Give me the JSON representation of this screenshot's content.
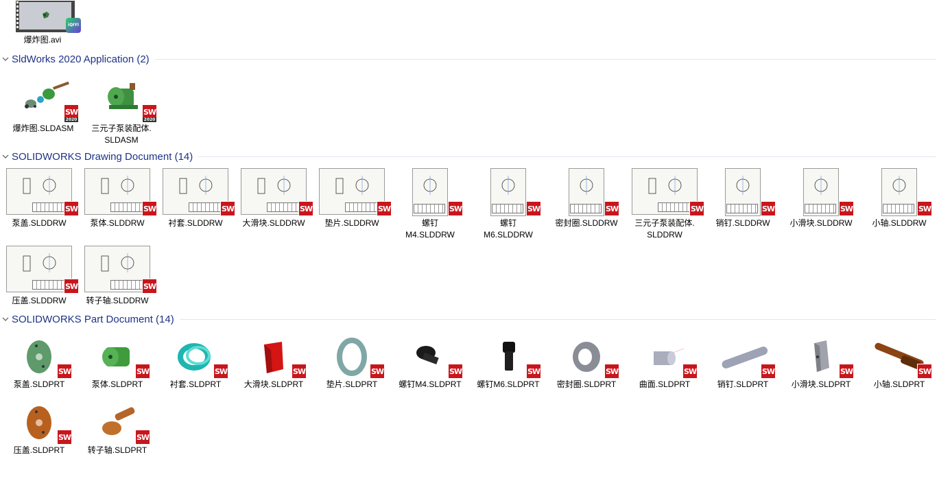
{
  "video": {
    "label": "爆炸图.avi",
    "badge": "iQIYI",
    "badge_color": "#2bd06a"
  },
  "groups": [
    {
      "title": "SldWorks 2020 Application (2)"
    },
    {
      "title": "SOLIDWORKS Drawing Document (14)"
    },
    {
      "title": "SOLIDWORKS Part Document (14)"
    }
  ],
  "sw_badge": {
    "text": "SW",
    "year": "2020",
    "color": "#c8161d"
  },
  "applications": [
    {
      "label": "爆炸图.SLDASM",
      "icon": "exploded-assembly-icon"
    },
    {
      "label": "三元子泵装配体.\nSLDASM",
      "icon": "pump-assembly-icon"
    }
  ],
  "drawings": [
    {
      "label": "泵盖.SLDDRW"
    },
    {
      "label": "泵体.SLDDRW"
    },
    {
      "label": "衬套.SLDDRW"
    },
    {
      "label": "大滑块.SLDDRW"
    },
    {
      "label": "垫片.SLDDRW"
    },
    {
      "label": "螺钉\nM4.SLDDRW"
    },
    {
      "label": "螺钉\nM6.SLDDRW"
    },
    {
      "label": "密封圈.SLDDRW"
    },
    {
      "label": "三元子泵装配体.\nSLDDRW"
    },
    {
      "label": "销钉.SLDDRW"
    },
    {
      "label": "小滑块.SLDDRW"
    },
    {
      "label": "小轴.SLDDRW"
    },
    {
      "label": "压盖.SLDDRW"
    },
    {
      "label": "转子轴.SLDDRW"
    }
  ],
  "parts": [
    {
      "label": "泵盖.SLDPRT",
      "icon": "pump-cover-icon",
      "color": "#5e9a6a"
    },
    {
      "label": "泵体.SLDPRT",
      "icon": "pump-body-icon",
      "color": "#3f9b3c"
    },
    {
      "label": "衬套.SLDPRT",
      "icon": "bushing-icon",
      "color": "#1fb5b0"
    },
    {
      "label": "大滑块.SLDPRT",
      "icon": "large-slider-icon",
      "color": "#d51414"
    },
    {
      "label": "垫片.SLDPRT",
      "icon": "gasket-icon",
      "color": "#7fa7a6"
    },
    {
      "label": "螺钉M4.SLDPRT",
      "icon": "screw-m4-icon",
      "color": "#1a1a1a"
    },
    {
      "label": "螺钉M6.SLDPRT",
      "icon": "screw-m6-icon",
      "color": "#111111"
    },
    {
      "label": "密封圈.SLDPRT",
      "icon": "seal-ring-icon",
      "color": "#8a8d96"
    },
    {
      "label": "曲面.SLDPRT",
      "icon": "surface-icon",
      "color": "#a9adbc"
    },
    {
      "label": "销钉.SLDPRT",
      "icon": "pin-icon",
      "color": "#9da2b4"
    },
    {
      "label": "小滑块.SLDPRT",
      "icon": "small-slider-icon",
      "color": "#a0a3ab"
    },
    {
      "label": "小轴.SLDPRT",
      "icon": "small-shaft-icon",
      "color": "#8b4513"
    },
    {
      "label": "压盖.SLDPRT",
      "icon": "gland-icon",
      "color": "#b8611f"
    },
    {
      "label": "转子轴.SLDPRT",
      "icon": "rotor-shaft-icon",
      "color": "#c0702a"
    }
  ]
}
